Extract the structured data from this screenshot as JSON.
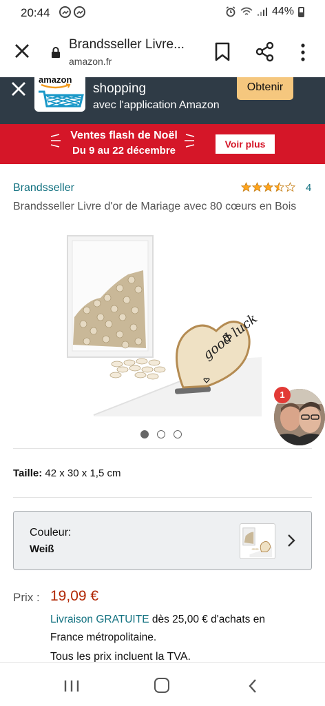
{
  "status_bar": {
    "time": "20:44",
    "battery": "44%"
  },
  "browser": {
    "page_title": "Brandsseller Livre...",
    "url": "amazon.fr"
  },
  "app_banner": {
    "logo_text": "amazon",
    "line1": "shopping",
    "line2": "avec l'application Amazon",
    "button": "Obtenir"
  },
  "promo": {
    "title": "Ventes flash de Noël",
    "dates": "Du 9 au 22 décembre",
    "button": "Voir plus"
  },
  "product": {
    "brand": "Brandsseller",
    "rating_count": "4",
    "rating_stars": 3.5,
    "title": "Brandsseller Livre d'or de Mariage avec 80 cœurs en Bois",
    "image_text": "good luck",
    "carousel_count": 3,
    "carousel_active": 1,
    "size_label": "Taille:",
    "size_value": "42 x 30 x 1,5 cm",
    "color_label": "Couleur:",
    "color_value": "Weiß",
    "price_label": "Prix :",
    "price_value": "19,09 €",
    "delivery_free": "Livraison GRATUITE",
    "delivery_rest": " dès 25,00 € d'achats en France métropolitaine.",
    "vat_note": "Tous les prix incluent la TVA."
  },
  "chat_head": {
    "badge": "1"
  },
  "colors": {
    "brand_link": "#137281",
    "price": "#b12704",
    "promo_red": "#d51628",
    "banner_dark": "#2f3b46",
    "banner_button": "#f5c77e"
  }
}
